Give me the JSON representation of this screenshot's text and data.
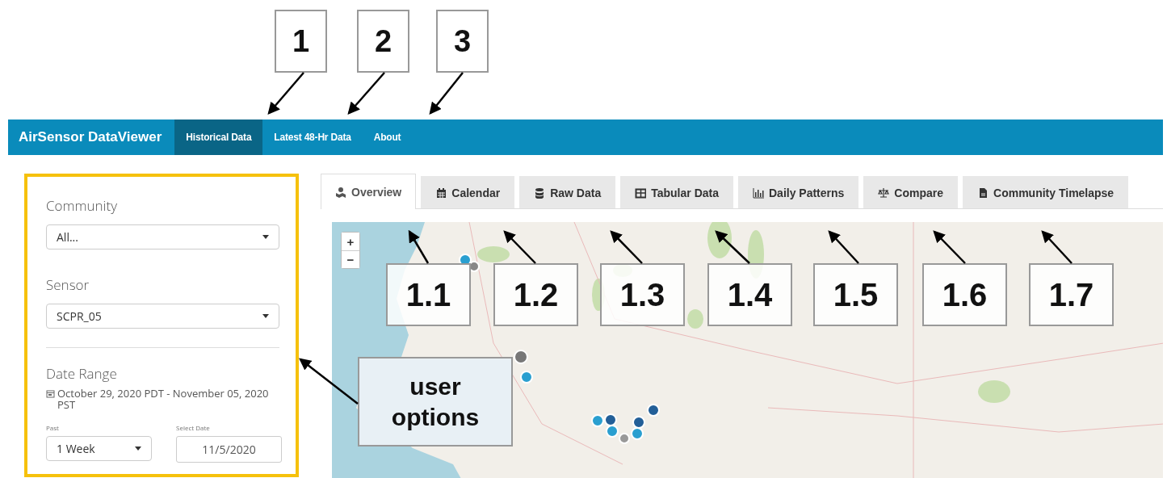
{
  "nav": {
    "brand": "AirSensor DataViewer",
    "items": [
      {
        "label": "Historical Data",
        "selected": true
      },
      {
        "label": "Latest 48-Hr Data",
        "selected": false
      },
      {
        "label": "About",
        "selected": false
      }
    ]
  },
  "sidebar": {
    "community": {
      "label": "Community",
      "value": "All..."
    },
    "sensor": {
      "label": "Sensor",
      "value": "SCPR_05"
    },
    "date_range": {
      "label": "Date Range",
      "text": "October 29, 2020 PDT - November 05, 2020 PST"
    },
    "past": {
      "label": "Past",
      "value": "1 Week"
    },
    "select_date": {
      "label": "Select Date",
      "value": "11/5/2020"
    }
  },
  "tabs": [
    {
      "label": "Overview",
      "selected": true
    },
    {
      "label": "Calendar",
      "selected": false
    },
    {
      "label": "Raw Data",
      "selected": false
    },
    {
      "label": "Tabular Data",
      "selected": false
    },
    {
      "label": "Daily Patterns",
      "selected": false
    },
    {
      "label": "Compare",
      "selected": false
    },
    {
      "label": "Community Timelapse",
      "selected": false
    }
  ],
  "map": {
    "zoom_in": "+",
    "zoom_out": "−"
  },
  "annotations": {
    "nav_callouts": [
      "1",
      "2",
      "3"
    ],
    "tab_callouts": [
      "1.1",
      "1.2",
      "1.3",
      "1.4",
      "1.5",
      "1.6",
      "1.7"
    ],
    "sidebar_callout": "user options"
  }
}
